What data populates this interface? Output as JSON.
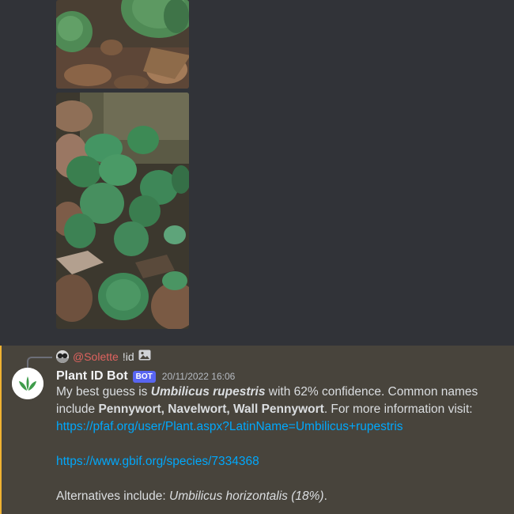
{
  "reply": {
    "author": "@Solette",
    "text": "!id"
  },
  "message": {
    "username": "Plant ID Bot",
    "bot_tag": "BOT",
    "timestamp": "20/11/2022 16:06",
    "intro": "My best guess is ",
    "species": "Umbilicus rupestris",
    "confidence_text": " with 62% confidence. Common names include ",
    "common_names": "Pennywort, Navelwort, Wall Pennywort",
    "more_info": ". For more information visit:",
    "link_pfaf": "https://pfaf.org/user/Plant.aspx?LatinName=Umbilicus+rupestris",
    "link_gbif": "https://www.gbif.org/species/7334368",
    "alternatives_prefix": "Alternatives include: ",
    "alternatives": "Umbilicus horizontalis (18%)",
    "alternatives_suffix": "."
  },
  "colors": {
    "background": "#313338",
    "highlight": "#48443c",
    "mention_bar": "#f0b232",
    "link": "#00a8fc",
    "bot_tag": "#5865f2",
    "reply_author": "#e0635f"
  },
  "icons": {
    "reply_attachment": "image-icon",
    "bot_avatar": "plant-leaves-icon"
  }
}
